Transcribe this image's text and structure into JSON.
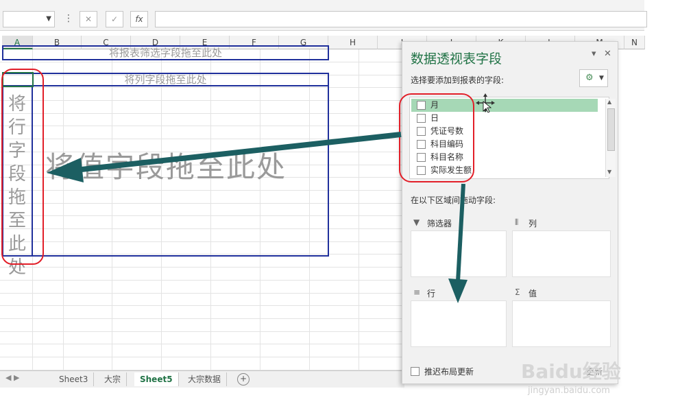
{
  "formula_bar": {
    "fx_label": "fx"
  },
  "columns": [
    "A",
    "B",
    "C",
    "D",
    "E",
    "F",
    "G",
    "H",
    "I",
    "J",
    "K",
    "L",
    "M",
    "N"
  ],
  "drop_zones": {
    "filter_text": "将报表筛选字段拖至此处",
    "column_text": "将列字段拖至此处",
    "value_text": "将值字段拖至此处",
    "row_text": "将行字段拖至此处"
  },
  "sheet_tabs": [
    "Sheet3",
    "大宗",
    "Sheet5",
    "大宗数据"
  ],
  "active_tab_index": 2,
  "pivot_panel": {
    "title": "数据透视表字段",
    "choose_fields_label": "选择要添加到报表的字段:",
    "fields": [
      "月",
      "日",
      "凭证号数",
      "科目编码",
      "科目名称",
      "实际发生额"
    ],
    "highlighted_field_index": 0,
    "drag_areas_label": "在以下区域间拖动字段:",
    "areas": {
      "filters": "筛选器",
      "columns": "列",
      "rows": "行",
      "values": "值"
    },
    "defer_update_label": "推迟布局更新",
    "update_button": "更新"
  },
  "watermark": {
    "brand": "Baidu经验",
    "url": "jingyan.baidu.com"
  },
  "colors": {
    "excel_green": "#217346",
    "dropzone_border": "#1f2f9b",
    "highlight_circle": "#e21e28",
    "arrow": "#1c5f62",
    "selected_field": "#a6d8b6"
  }
}
